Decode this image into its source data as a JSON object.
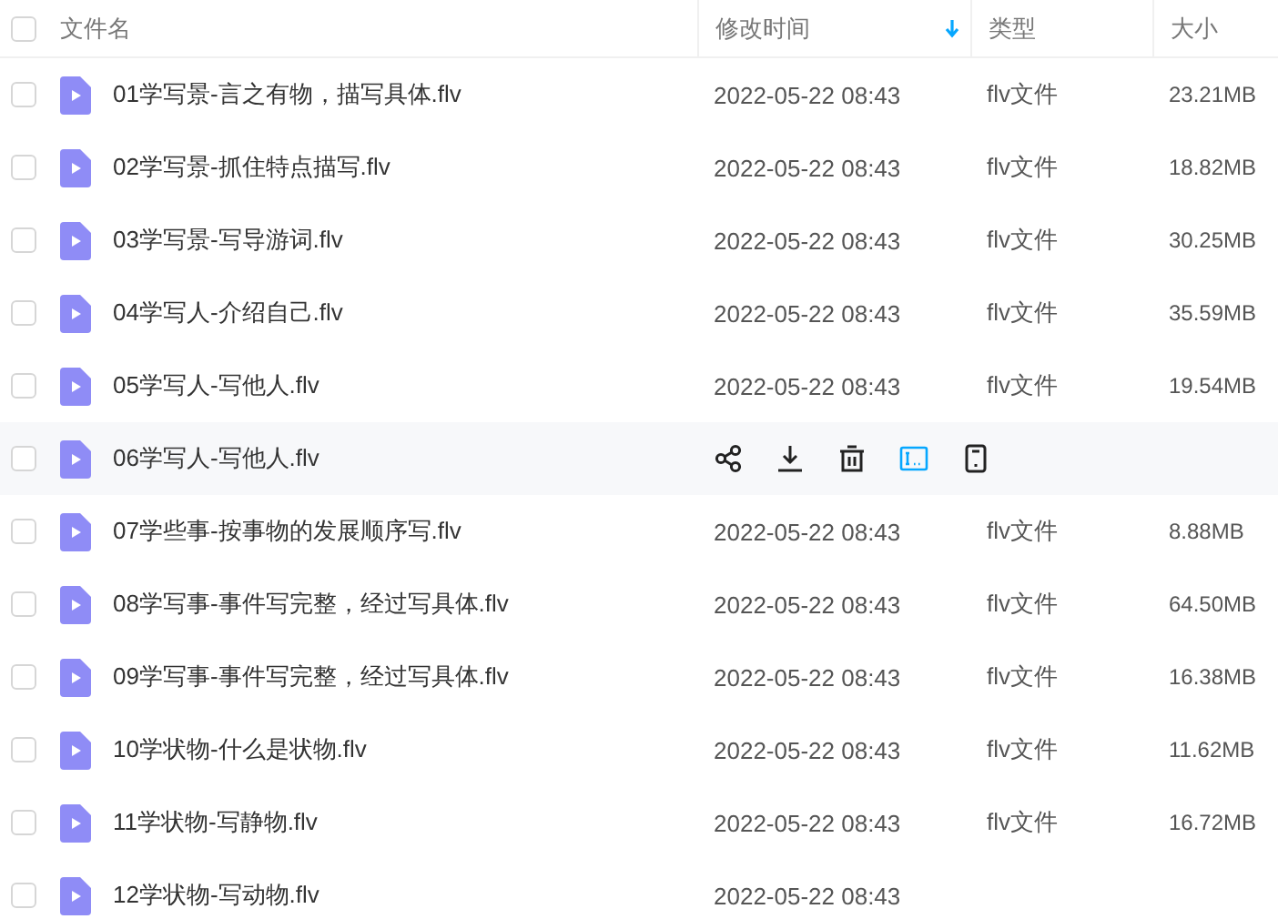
{
  "table": {
    "all_checked": false,
    "columns": [
      {
        "label": "文件名",
        "sorted": false
      },
      {
        "label": "修改时间",
        "sorted": true
      },
      {
        "label": "类型",
        "sorted": false
      },
      {
        "label": "大小",
        "sorted": false
      }
    ],
    "rows": [
      {
        "name": "01学写景-言之有物，描写具体.flv",
        "time": "2022-05-22 08:43",
        "type": "flv文件",
        "size": "23.21MB",
        "checked": false,
        "hovered": false
      },
      {
        "name": "02学写景-抓住特点描写.flv",
        "time": "2022-05-22 08:43",
        "type": "flv文件",
        "size": "18.82MB",
        "checked": false,
        "hovered": false
      },
      {
        "name": "03学写景-写导游词.flv",
        "time": "2022-05-22 08:43",
        "type": "flv文件",
        "size": "30.25MB",
        "checked": false,
        "hovered": false
      },
      {
        "name": "04学写人-介绍自己.flv",
        "time": "2022-05-22 08:43",
        "type": "flv文件",
        "size": "35.59MB",
        "checked": false,
        "hovered": false
      },
      {
        "name": "05学写人-写他人.flv",
        "time": "2022-05-22 08:43",
        "type": "flv文件",
        "size": "19.54MB",
        "checked": false,
        "hovered": false
      },
      {
        "name": "06学写人-写他人.flv",
        "checked": false,
        "hovered": true
      },
      {
        "name": "07学些事-按事物的发展顺序写.flv",
        "time": "2022-05-22 08:43",
        "type": "flv文件",
        "size": "8.88MB",
        "checked": false,
        "hovered": false
      },
      {
        "name": "08学写事-事件写完整，经过写具体.flv",
        "time": "2022-05-22 08:43",
        "type": "flv文件",
        "size": "64.50MB",
        "checked": false,
        "hovered": false
      },
      {
        "name": "09学写事-事件写完整，经过写具体.flv",
        "time": "2022-05-22 08:43",
        "type": "flv文件",
        "size": "16.38MB",
        "checked": false,
        "hovered": false
      },
      {
        "name": "10学状物-什么是状物.flv",
        "time": "2022-05-22 08:43",
        "type": "flv文件",
        "size": "11.62MB",
        "checked": false,
        "hovered": false
      },
      {
        "name": "11学状物-写静物.flv",
        "time": "2022-05-22 08:43",
        "type": "flv文件",
        "size": "16.72MB",
        "checked": false,
        "hovered": false
      },
      {
        "name": "12学状物-写动物.flv",
        "time": "2022-05-22 08:43",
        "checked": false,
        "hovered": false
      }
    ]
  }
}
